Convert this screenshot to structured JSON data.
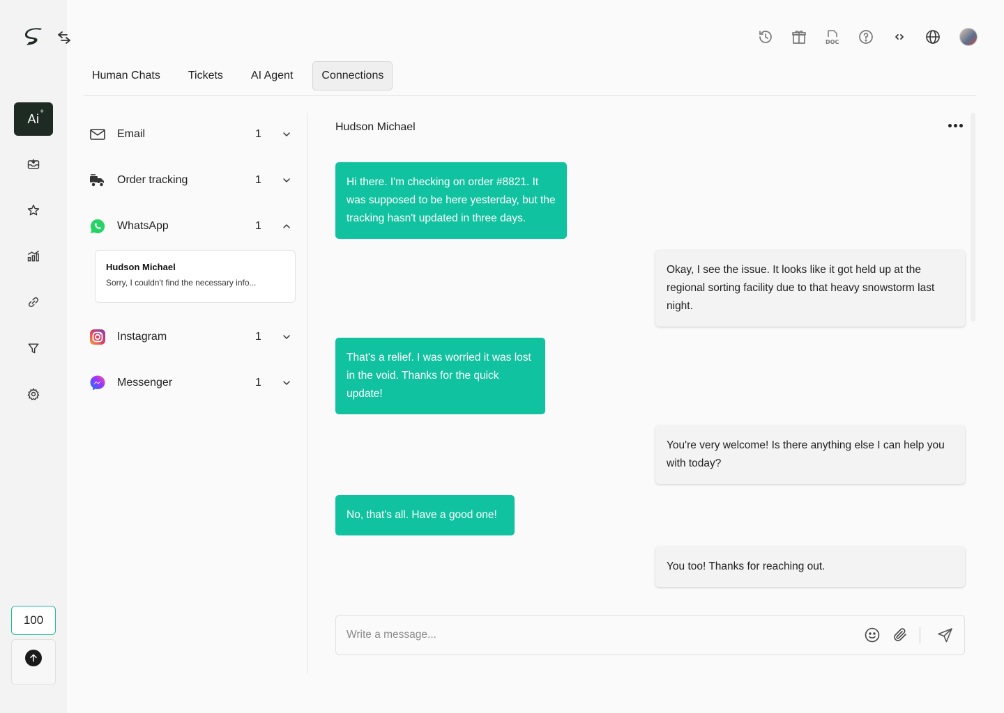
{
  "app": {
    "accent": "#10c29f",
    "credits": "100"
  },
  "tabs": [
    {
      "label": "Human Chats"
    },
    {
      "label": "Tickets"
    },
    {
      "label": "AI Agent"
    },
    {
      "label": "Connections",
      "active": true
    }
  ],
  "rail": {
    "active_label": "Ai"
  },
  "channels": [
    {
      "name": "Email",
      "count": "1",
      "icon": "mail-icon",
      "expanded": false
    },
    {
      "name": "Order tracking",
      "count": "1",
      "icon": "delivery-truck-icon",
      "expanded": false
    },
    {
      "name": "WhatsApp",
      "count": "1",
      "icon": "whatsapp-icon",
      "expanded": true
    },
    {
      "name": "Instagram",
      "count": "1",
      "icon": "instagram-icon",
      "expanded": false
    },
    {
      "name": "Messenger",
      "count": "1",
      "icon": "messenger-icon",
      "expanded": false
    }
  ],
  "conversation_card": {
    "name": "Hudson Michael",
    "preview": "Sorry, I couldn't find the necessary info..."
  },
  "chat": {
    "contact": "Hudson Michael",
    "messages": [
      {
        "from": "customer",
        "text": "Hi there. I'm checking on order #8821. It was supposed to be here yesterday, but the tracking hasn't updated in three days."
      },
      {
        "from": "agent",
        "text": "Okay, I see the issue. It looks like it got held up at the regional sorting facility due to that heavy snowstorm last night."
      },
      {
        "from": "customer",
        "text": "That's a relief. I was worried it was lost in the void. Thanks for the quick update!"
      },
      {
        "from": "agent",
        "text": "You're very welcome! Is there anything else I can help you with today?"
      },
      {
        "from": "customer",
        "text": "No, that's all. Have a good one!"
      },
      {
        "from": "agent",
        "text": "You too! Thanks for reaching out."
      }
    ],
    "composer_placeholder": "Write a message..."
  }
}
